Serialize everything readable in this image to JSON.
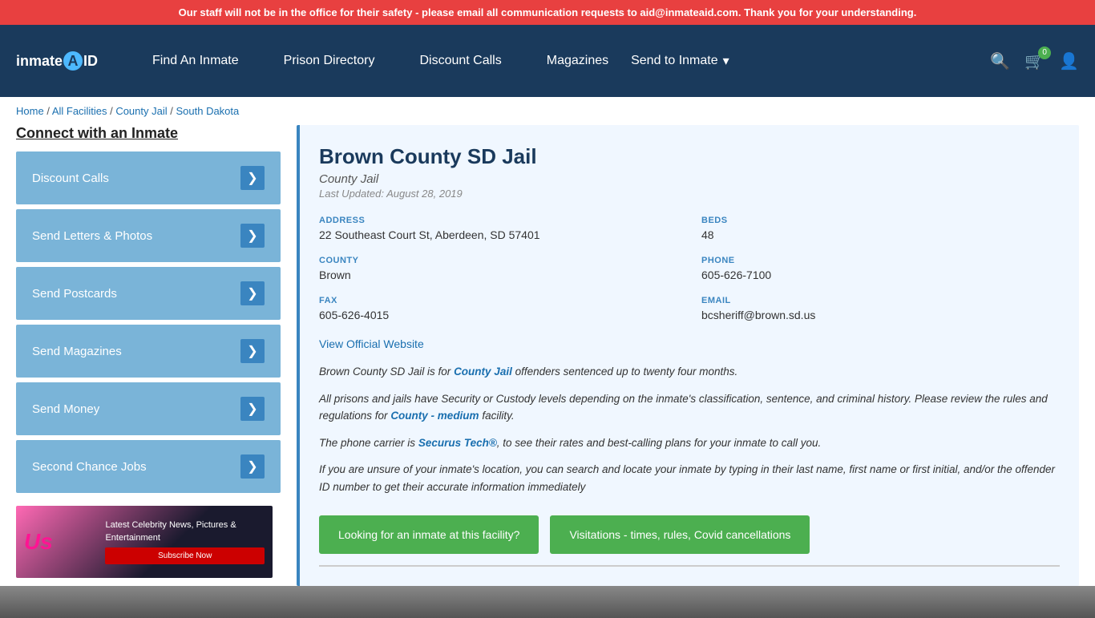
{
  "banner": {
    "text": "Our staff will not be in the office for their safety - please email all communication requests to aid@inmateaid.com. Thank you for your understanding."
  },
  "header": {
    "logo": "inmateAID",
    "nav": [
      {
        "label": "Find An Inmate",
        "id": "find-an-inmate"
      },
      {
        "label": "Prison Directory",
        "id": "prison-directory"
      },
      {
        "label": "Discount Calls",
        "id": "discount-calls"
      },
      {
        "label": "Magazines",
        "id": "magazines"
      },
      {
        "label": "Send to Inmate",
        "id": "send-to-inmate"
      }
    ],
    "cart_count": "0"
  },
  "breadcrumb": {
    "items": [
      "Home",
      "All Facilities",
      "County Jail",
      "South Dakota"
    ],
    "separators": [
      "/",
      "/",
      "/"
    ]
  },
  "sidebar": {
    "title": "Connect with an Inmate",
    "buttons": [
      {
        "label": "Discount Calls",
        "id": "btn-discount-calls"
      },
      {
        "label": "Send Letters & Photos",
        "id": "btn-send-letters"
      },
      {
        "label": "Send Postcards",
        "id": "btn-send-postcards"
      },
      {
        "label": "Send Magazines",
        "id": "btn-send-magazines"
      },
      {
        "label": "Send Money",
        "id": "btn-send-money"
      },
      {
        "label": "Second Chance Jobs",
        "id": "btn-second-chance"
      }
    ],
    "ad": {
      "brand": "Us",
      "text": "Latest Celebrity News, Pictures & Entertainment",
      "cta": "Subscribe Now"
    }
  },
  "facility": {
    "name": "Brown County SD Jail",
    "type": "County Jail",
    "last_updated": "Last Updated: August 28, 2019",
    "address_label": "ADDRESS",
    "address": "22 Southeast Court St, Aberdeen, SD 57401",
    "beds_label": "BEDS",
    "beds": "48",
    "county_label": "COUNTY",
    "county": "Brown",
    "phone_label": "PHONE",
    "phone": "605-626-7100",
    "fax_label": "FAX",
    "fax": "605-626-4015",
    "email_label": "EMAIL",
    "email": "bcsheriff@brown.sd.us",
    "official_website_label": "View Official Website",
    "description1": "Brown County SD Jail is for County Jail offenders sentenced up to twenty four months.",
    "description2": "All prisons and jails have Security or Custody levels depending on the inmate's classification, sentence, and criminal history. Please review the rules and regulations for County - medium facility.",
    "description3": "The phone carrier is Securus Tech®, to see their rates and best-calling plans for your inmate to call you.",
    "description4": "If you are unsure of your inmate's location, you can search and locate your inmate by typing in their last name, first name or first initial, and/or the offender ID number to get their accurate information immediately",
    "btn_find_inmate": "Looking for an inmate at this facility?",
    "btn_visitations": "Visitations - times, rules, Covid cancellations"
  }
}
